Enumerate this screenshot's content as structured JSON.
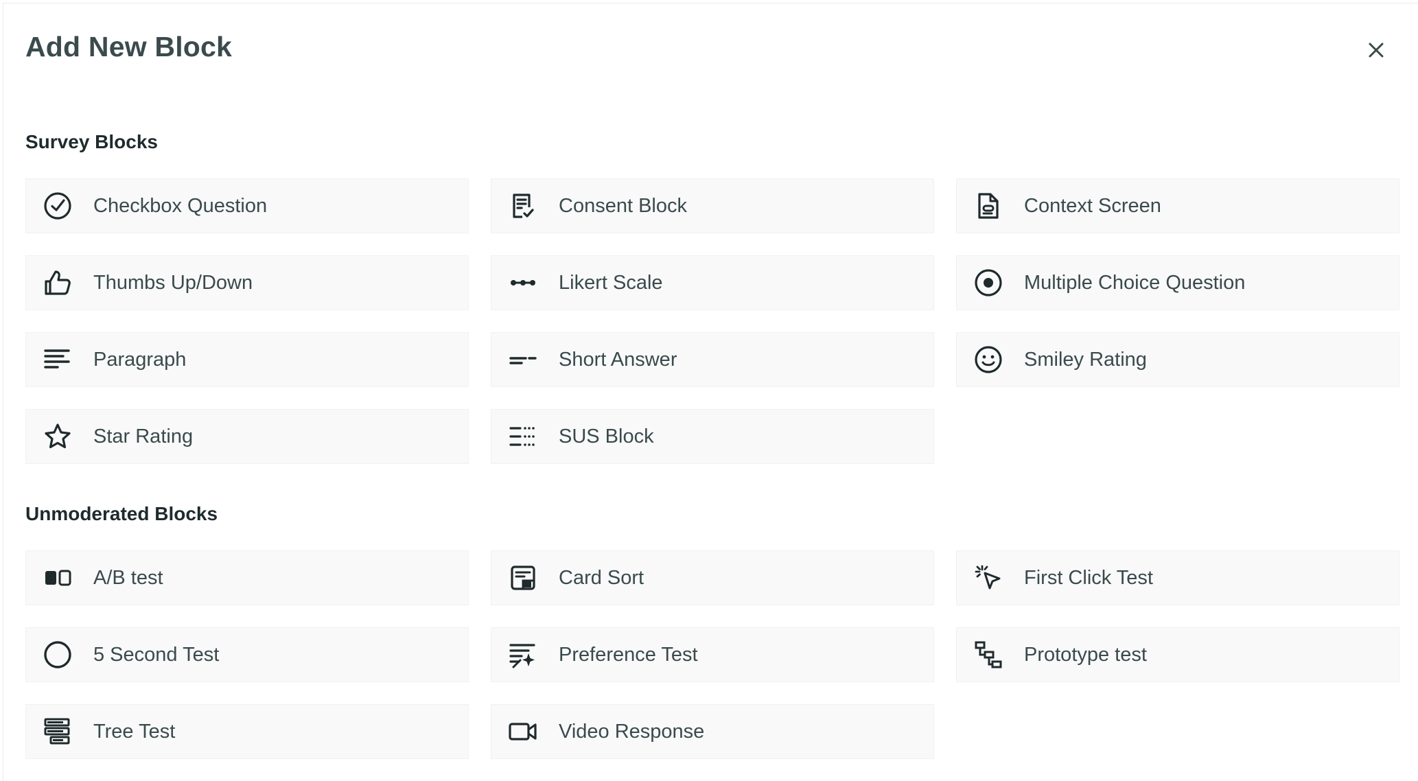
{
  "modal": {
    "title": "Add New Block",
    "close_icon": "close-icon"
  },
  "sections": [
    {
      "title": "Survey Blocks",
      "items": [
        {
          "label": "Checkbox Question",
          "icon": "check-circle-icon"
        },
        {
          "label": "Consent Block",
          "icon": "consent-document-icon"
        },
        {
          "label": "Context Screen",
          "icon": "document-icon"
        },
        {
          "label": "Thumbs Up/Down",
          "icon": "thumbs-up-icon"
        },
        {
          "label": "Likert Scale",
          "icon": "likert-dots-icon"
        },
        {
          "label": "Multiple Choice Question",
          "icon": "radio-icon"
        },
        {
          "label": "Paragraph",
          "icon": "paragraph-lines-icon"
        },
        {
          "label": "Short Answer",
          "icon": "short-answer-icon"
        },
        {
          "label": "Smiley Rating",
          "icon": "smiley-icon"
        },
        {
          "label": "Star Rating",
          "icon": "star-icon"
        },
        {
          "label": "SUS Block",
          "icon": "sus-list-icon"
        }
      ]
    },
    {
      "title": "Unmoderated Blocks",
      "items": [
        {
          "label": "A/B test",
          "icon": "ab-test-icon"
        },
        {
          "label": "Card Sort",
          "icon": "card-sort-icon"
        },
        {
          "label": "First Click Test",
          "icon": "click-cursor-icon"
        },
        {
          "label": "5 Second Test",
          "icon": "circle-icon"
        },
        {
          "label": "Preference Test",
          "icon": "preference-sparkle-icon"
        },
        {
          "label": "Prototype test",
          "icon": "prototype-flow-icon"
        },
        {
          "label": "Tree Test",
          "icon": "tree-test-icon"
        },
        {
          "label": "Video Response",
          "icon": "video-camera-icon"
        }
      ]
    }
  ],
  "colors": {
    "text": "#3a4a4c",
    "heading": "#1f2a2c",
    "tile_bg": "#f9f9f9",
    "icon": "#1f2a2c"
  }
}
